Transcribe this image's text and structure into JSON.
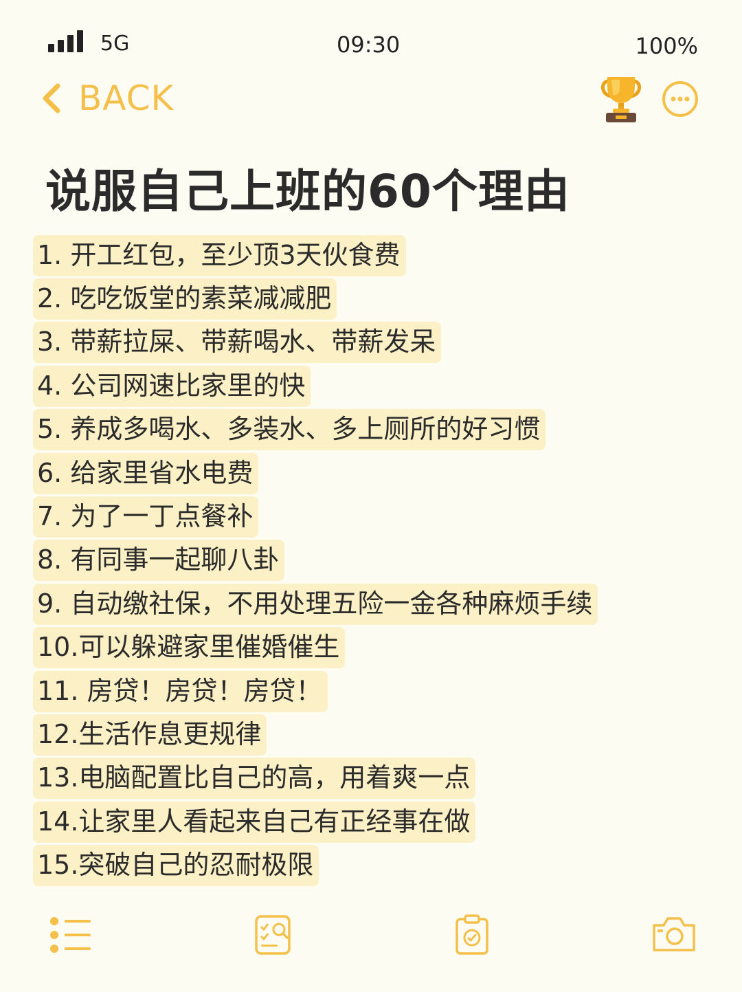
{
  "status_bar": {
    "network": "5G",
    "time": "09:30",
    "battery": "100%"
  },
  "nav": {
    "back_label": "BACK",
    "icons": [
      "chevron-left-icon",
      "trophy-icon",
      "more-icon"
    ]
  },
  "title": "说服自己上班的60个理由",
  "reasons": [
    "1. 开工红包，至少顶3天伙食费",
    "2. 吃吃饭堂的素菜减减肥",
    "3. 带薪拉屎、带薪喝水、带薪发呆",
    "4. 公司网速比家里的快",
    "5. 养成多喝水、多装水、多上厕所的好习惯",
    "6. 给家里省水电费",
    "7. 为了一丁点餐补",
    "8. 有同事一起聊八卦",
    "9. 自动缴社保，不用处理五险一金各种麻烦手续",
    "10.可以躲避家里催婚催生",
    "11. 房贷！房贷！房贷！",
    "12.生活作息更规律",
    "13.电脑配置比自己的高，用着爽一点",
    "14.让家里人看起来自己有正经事在做",
    "15.突破自己的忍耐极限"
  ],
  "bottom_tabs": [
    "list-icon",
    "checklist-search-icon",
    "clipboard-check-icon",
    "camera-icon"
  ],
  "colors": {
    "accent": "#F5C04A",
    "highlight": "#FBF0C6",
    "background": "#FDFCF3",
    "text": "#2B2B2B"
  }
}
